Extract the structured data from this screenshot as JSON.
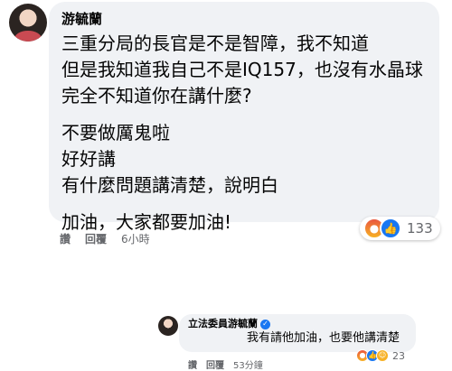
{
  "main_comment": {
    "author": "游毓蘭",
    "lines": [
      "三重分局的長官是不是智障，我不知道",
      "但是我知道我自己不是IQ157，也沒有水晶球",
      "完全不知道你在講什麼?",
      "不要做厲鬼啦",
      "好好講",
      "有什麼問題講清楚，說明白",
      "加油，大家都要加油!"
    ],
    "reaction_count": "133",
    "actions": {
      "like": "讚",
      "reply": "回覆",
      "time": "6小時"
    }
  },
  "reply_comment": {
    "author": "立法委員游毓蘭",
    "text": "我有請他加油，也要他講清楚",
    "reaction_count": "23",
    "actions": {
      "like": "讚",
      "reply": "回覆",
      "time": "53分鐘"
    }
  },
  "icons": {
    "reactions": [
      "angry-icon",
      "like-icon",
      "haha-icon"
    ],
    "verified": "verified-badge-icon"
  },
  "colors": {
    "bubble": "#f0f2f5",
    "like_blue": "#1877f2",
    "meta_gray": "#65676b"
  }
}
